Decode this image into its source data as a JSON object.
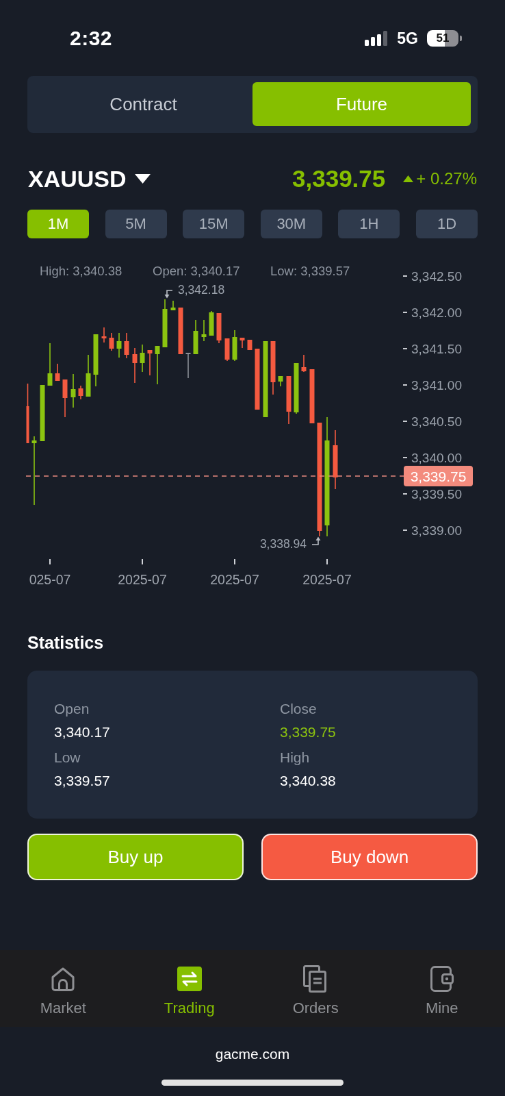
{
  "status_bar": {
    "time": "2:32",
    "network": "5G",
    "battery": "51"
  },
  "mode_tabs": [
    {
      "label": "Contract",
      "selected": false
    },
    {
      "label": "Future",
      "selected": true
    }
  ],
  "instrument": {
    "symbol": "XAUUSD",
    "price": "3,339.75",
    "change": "+ 0.27%",
    "rising": true
  },
  "intervals": [
    {
      "label": "1M",
      "selected": true
    },
    {
      "label": "5M",
      "selected": false
    },
    {
      "label": "15M",
      "selected": false
    },
    {
      "label": "30M",
      "selected": false
    },
    {
      "label": "1H",
      "selected": false
    },
    {
      "label": "1D",
      "selected": false
    }
  ],
  "chart": {
    "summary": [
      "High: 3,340.38",
      "Open: 3,340.17",
      "Low: 3,339.57"
    ],
    "y_axis_labels": [
      "3,342.50",
      "3,342.00",
      "3,341.50",
      "3,341.00",
      "3,340.50",
      "3,340.00",
      "3,339.50",
      "3,339.00"
    ],
    "x_axis_labels": [
      "025-07",
      "2025-07",
      "2025-07",
      "2025-07"
    ],
    "high_marker": "3,342.18",
    "low_marker": "3,338.94",
    "last_price": "3,339.75"
  },
  "statistics": {
    "title": "Statistics",
    "items": [
      {
        "label": "Open",
        "value": "3,340.17",
        "highlighted": false
      },
      {
        "label": "Close",
        "value": "3,339.75",
        "highlighted": true
      },
      {
        "label": "Low",
        "value": "3,339.57",
        "highlighted": false
      },
      {
        "label": "High",
        "value": "3,340.38",
        "highlighted": false
      }
    ]
  },
  "actions": [
    {
      "label": "Buy up",
      "kind": "up"
    },
    {
      "label": "Buy down",
      "kind": "down"
    }
  ],
  "bottom_nav": [
    {
      "label": "Market",
      "selected": false
    },
    {
      "label": "Trading",
      "selected": true
    },
    {
      "label": "Orders",
      "selected": false
    },
    {
      "label": "Mine",
      "selected": false
    }
  ],
  "footer": {
    "domain": "gacme.com"
  }
}
